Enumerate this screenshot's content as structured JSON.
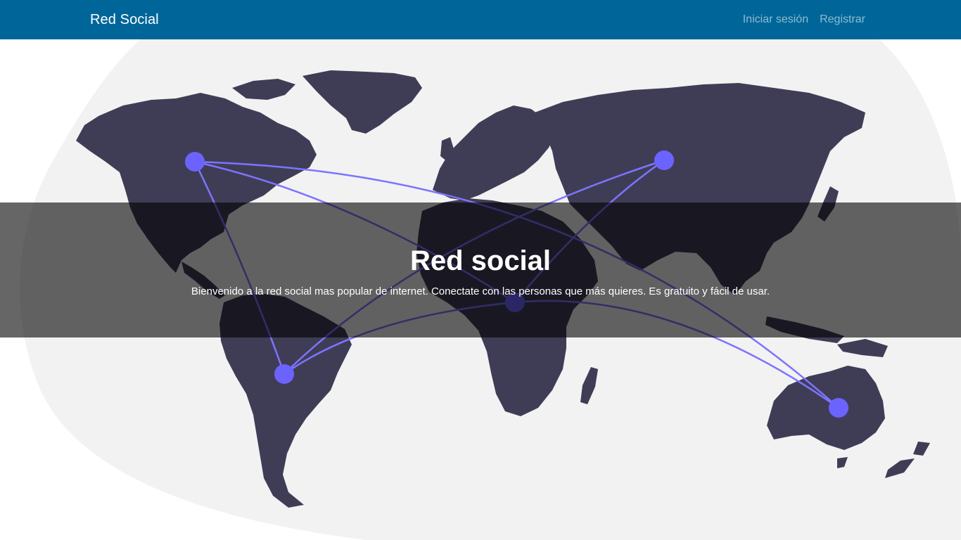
{
  "colors": {
    "navbar": "#006699",
    "blob": "#f2f2f2",
    "continent": "#3f3d56",
    "node": "#6c63ff",
    "link": "#7c74ff"
  },
  "navbar": {
    "brand": "Red Social",
    "links": [
      {
        "label": "Iniciar sesión"
      },
      {
        "label": "Registrar"
      }
    ]
  },
  "hero": {
    "illustration": "world-map-network",
    "title": "Red social",
    "lead": "Bienvenido a la red social mas popular de internet. Conectate con las personas que más quieres. Es gratuito y fácil de usar."
  }
}
